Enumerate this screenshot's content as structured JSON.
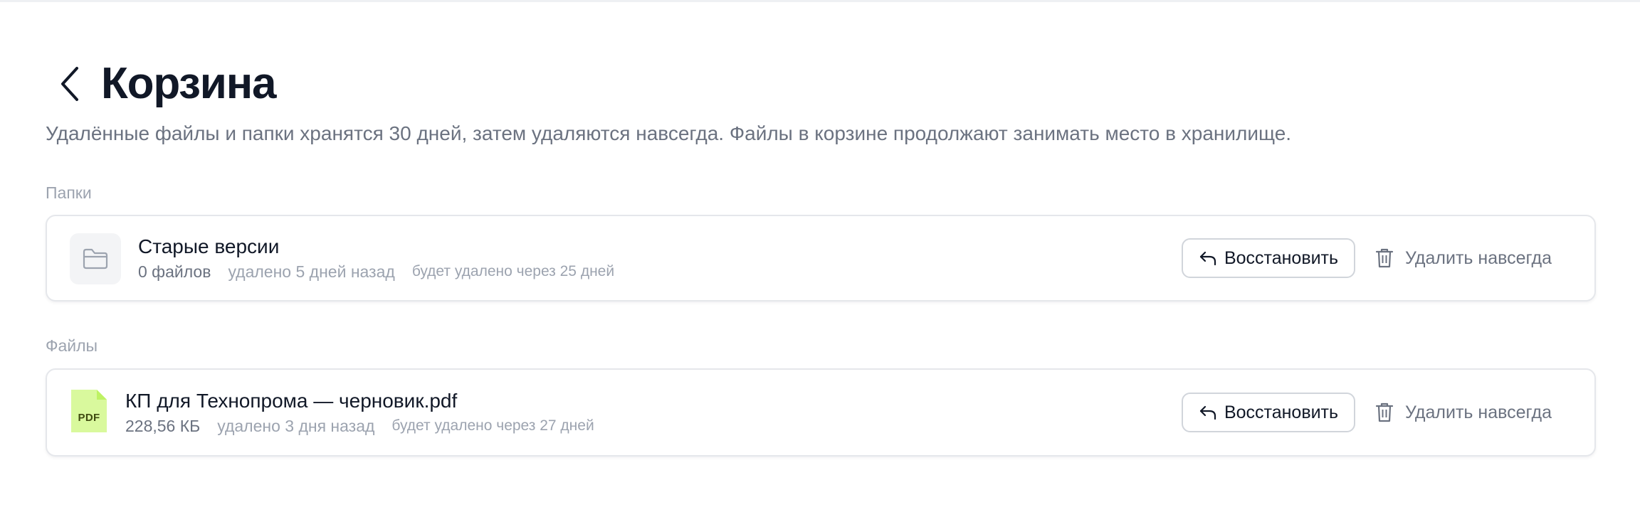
{
  "page": {
    "title": "Корзина",
    "subtitle": "Удалённые файлы и папки хранятся 30 дней, затем удаляются навсегда. Файлы в корзине продолжают занимать место в хранилище."
  },
  "sections": {
    "folders_label": "Папки",
    "files_label": "Файлы"
  },
  "folders": [
    {
      "name": "Старые версии",
      "size": "0 файлов",
      "deleted": "удалено 5 дней назад",
      "expires": "будет удалено через 25 дней",
      "icon": "folder-icon"
    }
  ],
  "files": [
    {
      "name": "КП для Технопрома — черновик.pdf",
      "size": "228,56 КБ",
      "deleted": "удалено 3 дня назад",
      "expires": "будет удалено через 27 дней",
      "icon": "pdf-file-icon",
      "badge": "PDF"
    }
  ],
  "actions": {
    "restore_label": "Восстановить",
    "delete_label": "Удалить навсегда"
  },
  "colors": {
    "title": "#111827",
    "muted": "#6b7280",
    "faint": "#9ca3af",
    "border": "#e5e7eb",
    "pdf_accent": "#d9f99d"
  }
}
